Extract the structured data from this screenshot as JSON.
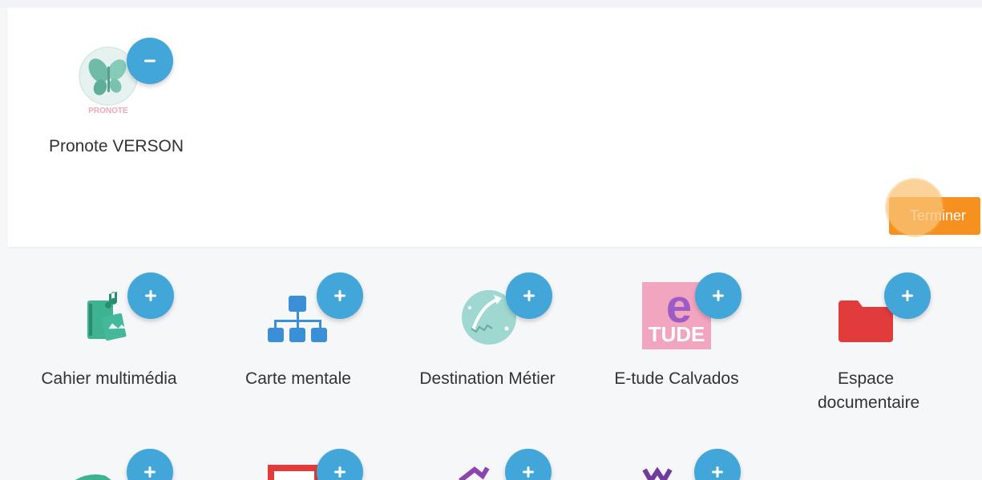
{
  "selected_apps": [
    {
      "label": "Pronote VERSON",
      "logo_text": "PRONOTE",
      "action": "remove"
    }
  ],
  "finish_button": {
    "label": "Terminer"
  },
  "available_apps": [
    {
      "label": "Cahier multimédia",
      "action": "add"
    },
    {
      "label": "Carte mentale",
      "action": "add"
    },
    {
      "label": "Destination Métier",
      "action": "add"
    },
    {
      "label": "E-tude Calvados",
      "action": "add",
      "logo_top": "e",
      "logo_bottom": "TUDE"
    },
    {
      "label": "Espace documentaire",
      "action": "add"
    }
  ],
  "colors": {
    "badge": "#43a6d9",
    "finish_button": "#f6901f",
    "panel_bg": "#ffffff",
    "page_bg": "#f6f7f9"
  }
}
